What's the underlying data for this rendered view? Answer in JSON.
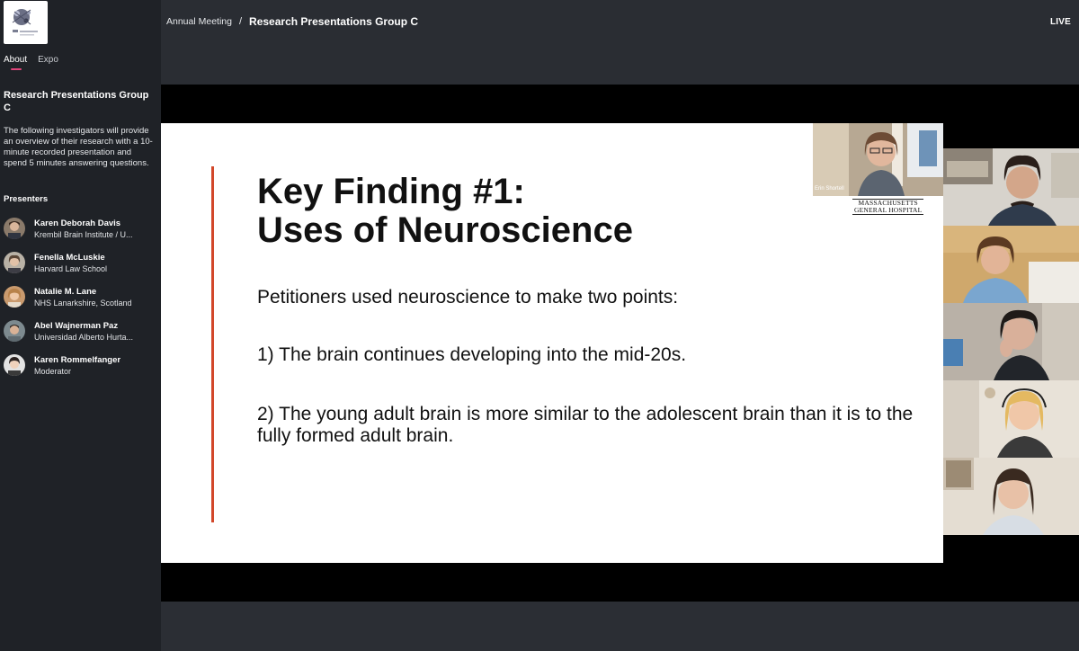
{
  "header": {
    "breadcrumb_parent": "Annual Meeting",
    "breadcrumb_separator": "/",
    "breadcrumb_current": "Research Presentations Group C",
    "live_label": "LIVE"
  },
  "sidebar": {
    "tabs": [
      {
        "label": "About",
        "active": true
      },
      {
        "label": "Expo",
        "active": false
      }
    ],
    "title": "Research Presentations Group C",
    "description": "The following investigators will provide an overview of their research with a 10-minute recorded presentation and spend 5 minutes answering questions.",
    "presenters_heading": "Presenters",
    "presenters": [
      {
        "name": "Karen Deborah Davis",
        "org": "Krembil Brain Institute / U..."
      },
      {
        "name": "Fenella McLuskie",
        "org": "Harvard Law School"
      },
      {
        "name": "Natalie M. Lane",
        "org": "NHS Lanarkshire, Scotland"
      },
      {
        "name": "Abel Wajnerman Paz",
        "org": "Universidad Alberto Hurta..."
      },
      {
        "name": "Karen Rommelfanger",
        "org": "Moderator"
      }
    ]
  },
  "slide": {
    "title_line1": "Key Finding #1:",
    "title_line2": "Uses of Neuroscience",
    "intro": "Petitioners used neuroscience to make two points:",
    "point1": "1) The brain continues developing into the mid-20s.",
    "point2": "2) The young adult brain is more similar to the adolescent brain than it is to the fully formed adult brain.",
    "accent_color": "#d2472a"
  },
  "speaker_inset": {
    "name": "Erin Shortell",
    "logo_line1": "MASSACHUSETTS",
    "logo_line2": "GENERAL HOSPITAL"
  },
  "colors": {
    "sidebar_bg": "#1f2227",
    "header_bg": "#2a2d33",
    "active_tab_indicator": "#e0457b"
  }
}
